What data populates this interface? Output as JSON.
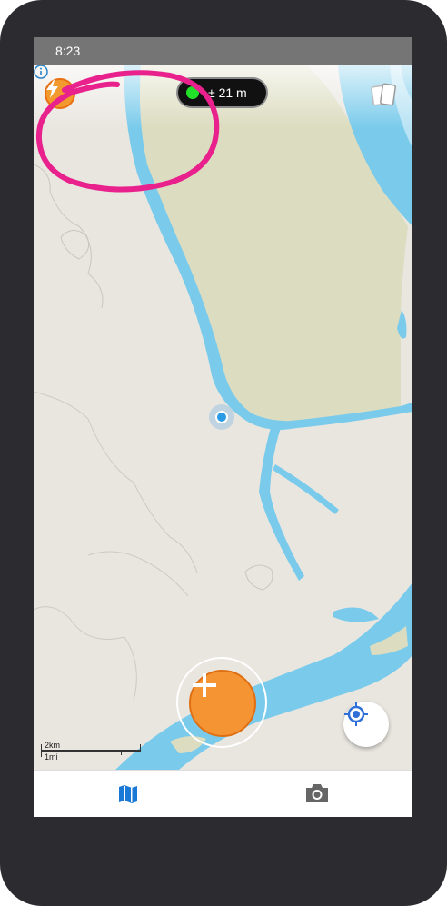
{
  "status_bar": {
    "time": "8:23"
  },
  "gps": {
    "accuracy": "± 21 m",
    "status_color": "#22e02a"
  },
  "scale": {
    "km_label": "2km",
    "mi_label": "1mi"
  },
  "icons": {
    "quick_action": "lightning-bolt-icon",
    "layers": "layers-icon",
    "add": "plus-icon",
    "locate": "crosshair-locate-icon",
    "info": "info-icon",
    "map_tab": "map-icon",
    "camera_tab": "camera-icon"
  },
  "colors": {
    "accent": "#f59433",
    "water": "#7acbeb",
    "land": "#e9e6e0",
    "island": "#dcdcc0",
    "highlight": "#e8218c",
    "nav_active": "#1a78d6",
    "nav_inactive": "#666666"
  },
  "bottom_nav": {
    "items": [
      {
        "icon": "map-icon",
        "active": true
      },
      {
        "icon": "camera-icon",
        "active": false
      }
    ]
  }
}
